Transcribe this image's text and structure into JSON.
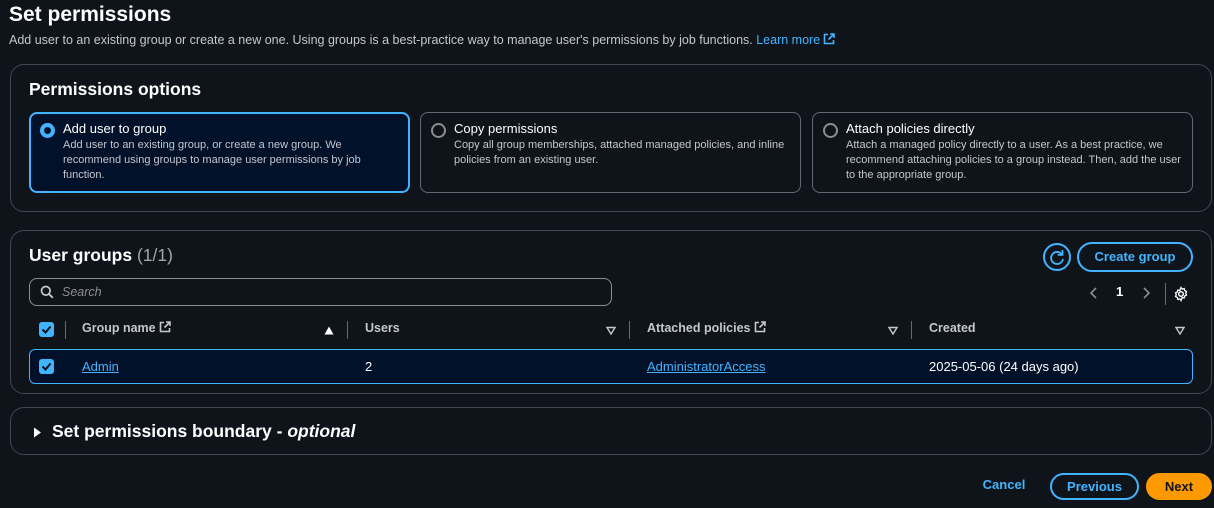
{
  "page": {
    "title": "Set permissions",
    "description": "Add user to an existing group or create a new one. Using groups is a best-practice way to manage user's permissions by job functions.",
    "learn_more": "Learn more"
  },
  "permissions_options": {
    "heading": "Permissions options",
    "options": [
      {
        "title": "Add user to group",
        "description": "Add user to an existing group, or create a new group. We recommend using groups to manage user permissions by job function.",
        "selected": true
      },
      {
        "title": "Copy permissions",
        "description": "Copy all group memberships, attached managed policies, and inline policies from an existing user.",
        "selected": false
      },
      {
        "title": "Attach policies directly",
        "description": "Attach a managed policy directly to a user. As a best practice, we recommend attaching policies to a group instead. Then, add the user to the appropriate group.",
        "selected": false
      }
    ]
  },
  "user_groups": {
    "heading": "User groups",
    "count": "(1/1)",
    "create_group_label": "Create group",
    "search_placeholder": "Search",
    "page_number": "1",
    "columns": [
      "Group name",
      "Users",
      "Attached policies",
      "Created"
    ],
    "rows": [
      {
        "group_name": "Admin",
        "users": "2",
        "attached_policies": "AdministratorAccess",
        "created": "2025-05-06 (24 days ago)",
        "checked": true
      }
    ]
  },
  "boundary": {
    "title": "Set permissions boundary - ",
    "optional": "optional"
  },
  "footer": {
    "cancel": "Cancel",
    "previous": "Previous",
    "next": "Next"
  },
  "colors": {
    "accent": "#42b4ff",
    "primary_button": "#ff9900",
    "background": "#0f141a",
    "selected_background": "#001129"
  }
}
